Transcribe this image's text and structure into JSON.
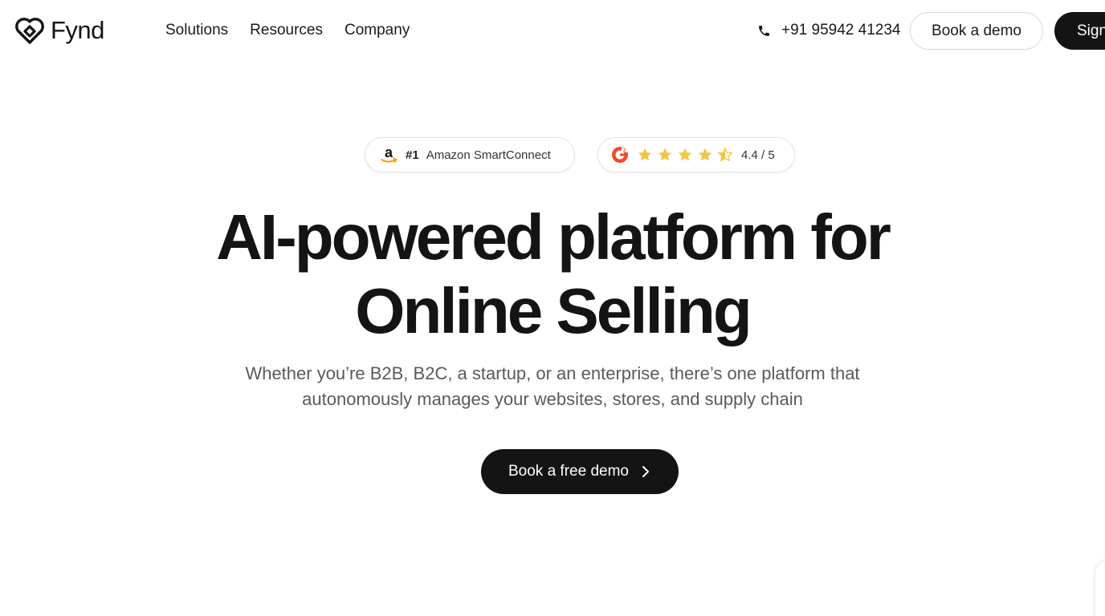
{
  "brand": {
    "name": "Fynd"
  },
  "nav": {
    "links": [
      "Solutions",
      "Resources",
      "Company"
    ],
    "phone": "+91 95942 41234",
    "book_demo_label": "Book a demo",
    "sign_label": "Sign"
  },
  "badges": {
    "amazon": {
      "rank": "#1",
      "label": "Amazon SmartConnect"
    },
    "g2": {
      "rating_text": "4.4 / 5",
      "rating": 4.4,
      "max": 5
    }
  },
  "hero": {
    "title_line1": "AI-powered platform for",
    "title_line2": "Online Selling",
    "subtitle_line1": "Whether you’re B2B, B2C, a startup, or an enterprise, there’s one platform that",
    "subtitle_line2": "autonomously manages your websites, stores, and supply chain",
    "cta_label": "Book a free demo"
  },
  "colors": {
    "primary_dark": "#141414",
    "star": "#f4c542",
    "g2_red": "#ef4b2a",
    "amazon_orange": "#ff9900"
  }
}
